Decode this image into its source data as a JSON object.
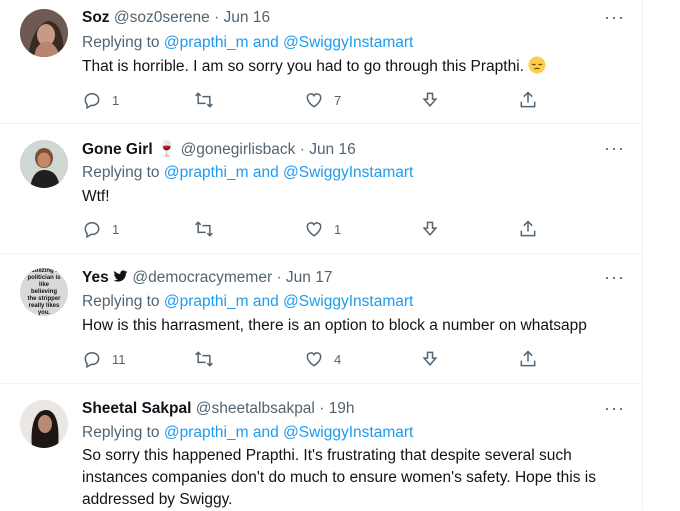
{
  "tweets": [
    {
      "name": "Soz",
      "handle": "@soz0serene",
      "separator": "·",
      "date": "Jun 16",
      "replying_prefix": "Replying to",
      "reply_user1": "@prapthi_m",
      "reply_and": "and",
      "reply_user2": "@SwiggyInstamart",
      "text": "That is horrible. I am so sorry you had to go through this Prapthi.",
      "emoji": "pensive-face-emoji",
      "replies": "1",
      "retweets": "",
      "likes": "7"
    },
    {
      "name": "Gone Girl",
      "name_emoji": "🍷",
      "handle": "@gonegirlisback",
      "separator": "·",
      "date": "Jun 16",
      "replying_prefix": "Replying to",
      "reply_user1": "@prapthi_m",
      "reply_and": "and",
      "reply_user2": "@SwiggyInstamart",
      "text": "Wtf!",
      "replies": "1",
      "retweets": "",
      "likes": "1"
    },
    {
      "name": "Yes",
      "handle": "@democracymemer",
      "separator": "·",
      "date": "Jun 17",
      "avatar_text": "Idolizing a politician is like believing the stripper really likes you.",
      "replying_prefix": "Replying to",
      "reply_user1": "@prapthi_m",
      "reply_and": "and",
      "reply_user2": "@SwiggyInstamart",
      "text": "How is this harrasment, there is an option to block a number on whatsapp",
      "replies": "11",
      "retweets": "",
      "likes": "4"
    },
    {
      "name": "Sheetal Sakpal",
      "handle": "@sheetalbsakpal",
      "separator": "·",
      "date": "19h",
      "replying_prefix": "Replying to",
      "reply_user1": "@prapthi_m",
      "reply_and": "and",
      "reply_user2": "@SwiggyInstamart",
      "text_lines": [
        "So sorry this happened Prapthi. It's frustrating that despite several such",
        "instances companies don't do much to ensure women's safety. Hope this is",
        "addressed by Swiggy."
      ]
    }
  ],
  "more_label": "···",
  "icons": [
    "reply-icon",
    "retweet-icon",
    "like-icon",
    "download-icon",
    "share-icon",
    "more-icon"
  ],
  "colors": {
    "link": "#1d9bf0",
    "muted": "#536471",
    "text": "#0f1419",
    "divider": "#eff3f4"
  }
}
